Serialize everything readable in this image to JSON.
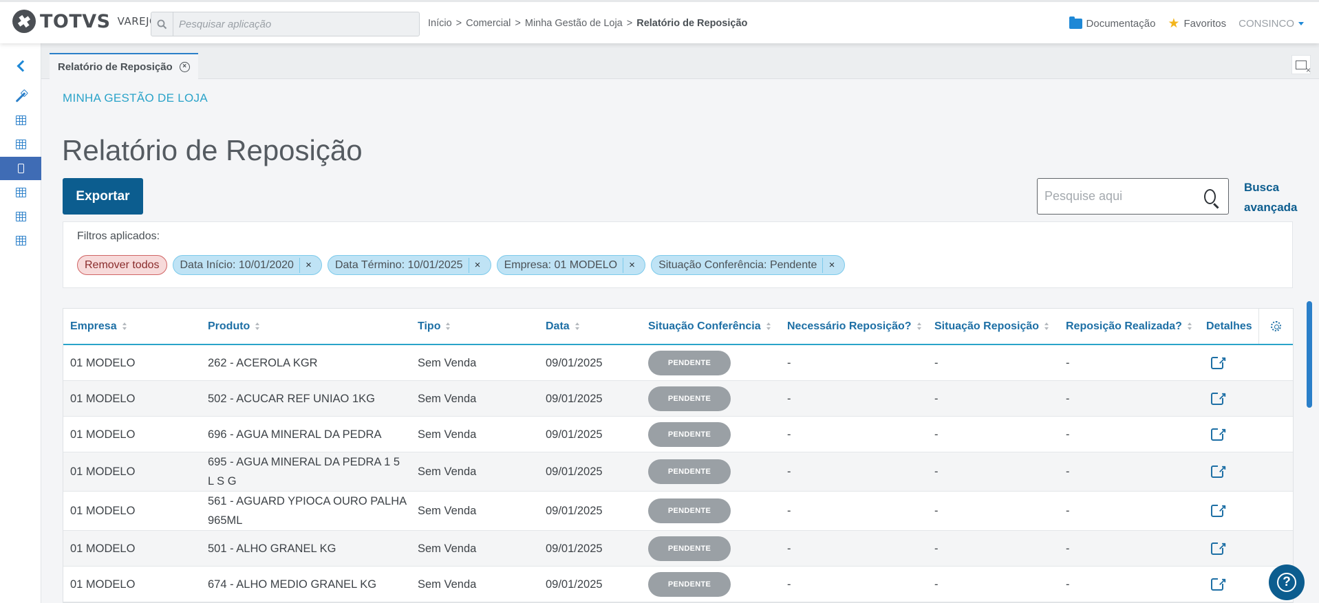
{
  "header": {
    "logo_text": "TOTVS",
    "logo_sub": "VAREJO",
    "search_placeholder": "Pesquisar aplicação",
    "breadcrumb": [
      "Início",
      "Comercial",
      "Minha Gestão de Loja",
      "Relatório de Reposição"
    ],
    "breadcrumb_sep": ">",
    "documentation": "Documentação",
    "favorites": "Favoritos",
    "user": "CONSINCO"
  },
  "tab": {
    "label": "Relatório de Reposição",
    "close_glyph": "×"
  },
  "content": {
    "section_label": "MINHA GESTÃO DE LOJA",
    "title": "Relatório de Reposição",
    "export_label": "Exportar",
    "search_placeholder": "Pesquise aqui",
    "advanced_search": "Busca avançada"
  },
  "filters": {
    "title": "Filtros aplicados:",
    "remove_all": "Remover todos",
    "chips": [
      "Data Início: 10/01/2020",
      "Data Término: 10/01/2025",
      "Empresa: 01 MODELO",
      "Situação Conferência: Pendente"
    ],
    "chip_close": "×"
  },
  "table": {
    "columns": [
      "Empresa",
      "Produto",
      "Tipo",
      "Data",
      "Situação Conferência",
      "Necessário Reposição?",
      "Situação Reposição",
      "Reposição Realizada?",
      "Detalhes"
    ],
    "rows": [
      [
        "01 MODELO",
        "262 - ACEROLA KGR",
        "Sem Venda",
        "09/01/2025",
        "PENDENTE",
        "-",
        "-",
        "-"
      ],
      [
        "01 MODELO",
        "502 - ACUCAR REF UNIAO 1KG",
        "Sem Venda",
        "09/01/2025",
        "PENDENTE",
        "-",
        "-",
        "-"
      ],
      [
        "01 MODELO",
        "696 - AGUA MINERAL DA PEDRA",
        "Sem Venda",
        "09/01/2025",
        "PENDENTE",
        "-",
        "-",
        "-"
      ],
      [
        "01 MODELO",
        "695 - AGUA MINERAL DA PEDRA 1 5 L S G",
        "Sem Venda",
        "09/01/2025",
        "PENDENTE",
        "-",
        "-",
        "-"
      ],
      [
        "01 MODELO",
        "561 - AGUARD YPIOCA OURO PALHA 965ML",
        "Sem Venda",
        "09/01/2025",
        "PENDENTE",
        "-",
        "-",
        "-"
      ],
      [
        "01 MODELO",
        "501 - ALHO GRANEL KG",
        "Sem Venda",
        "09/01/2025",
        "PENDENTE",
        "-",
        "-",
        "-"
      ],
      [
        "01 MODELO",
        "674 - ALHO MEDIO GRANEL KG",
        "Sem Venda",
        "09/01/2025",
        "PENDENTE",
        "-",
        "-",
        "-"
      ]
    ]
  },
  "colors": {
    "primary": "#0c5d8f",
    "accent": "#2aa3c9",
    "chip_bg": "#bfe3f5",
    "remove_chip_bg": "#f7dada",
    "badge_pending": "#9aa0a5"
  }
}
